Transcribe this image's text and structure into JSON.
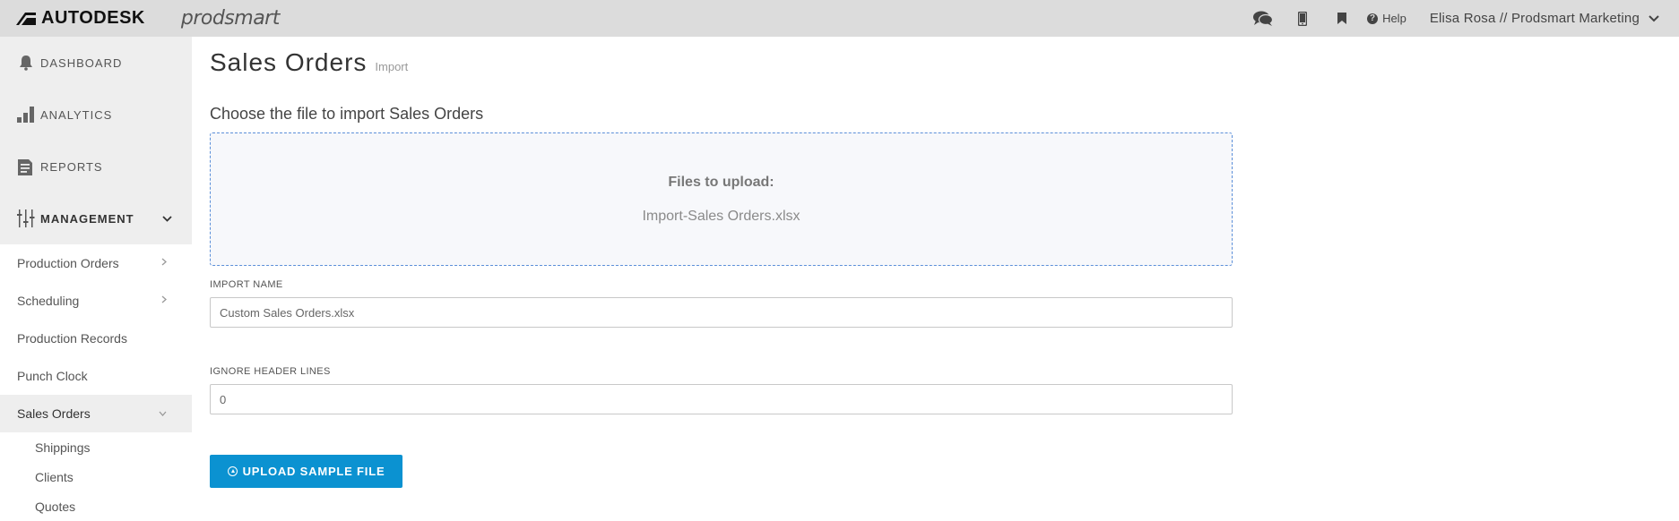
{
  "topbar": {
    "brand": "AUTODESK",
    "product": "prodsmart",
    "help_label": "Help",
    "user_label": "Elisa Rosa // Prodsmart Marketing",
    "icons": [
      "chat-icon",
      "mobile-icon",
      "bookmark-icon",
      "help-icon",
      "chevron-down-icon"
    ]
  },
  "sidebar": {
    "main_items": [
      {
        "label": "DASHBOARD",
        "icon": "bell-icon"
      },
      {
        "label": "ANALYTICS",
        "icon": "bar-chart-icon"
      },
      {
        "label": "REPORTS",
        "icon": "document-icon"
      },
      {
        "label": "MANAGEMENT",
        "icon": "sliders-icon"
      }
    ],
    "sub_items": [
      {
        "label": "Production Orders"
      },
      {
        "label": "Scheduling"
      },
      {
        "label": "Production Records"
      },
      {
        "label": "Punch Clock"
      },
      {
        "label": "Sales Orders"
      }
    ],
    "sub_sub_items": [
      {
        "label": "Shippings"
      },
      {
        "label": "Clients"
      },
      {
        "label": "Quotes"
      }
    ]
  },
  "main": {
    "title": "Sales Orders",
    "subtitle": "Import",
    "section_title": "Choose the file to import Sales Orders",
    "dropzone": {
      "title": "Files to upload:",
      "file_name": "Import-Sales Orders.xlsx"
    },
    "import_name": {
      "label": "IMPORT NAME",
      "value": "Custom Sales Orders.xlsx"
    },
    "ignore_header": {
      "label": "IGNORE HEADER LINES",
      "value": "0"
    },
    "upload_button": "UPLOAD SAMPLE FILE"
  },
  "colors": {
    "accent": "#0b92d1",
    "topbar_bg": "#dcdcdc",
    "dropzone_border": "#5b8fd9"
  }
}
